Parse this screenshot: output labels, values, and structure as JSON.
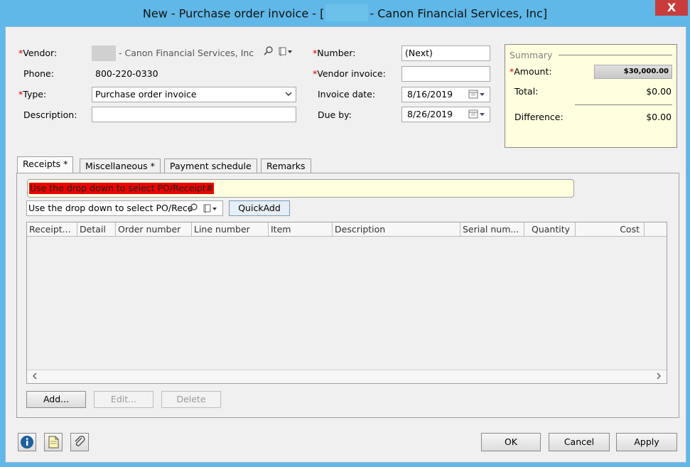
{
  "window": {
    "title_prefix": "New - Purchase order invoice - [",
    "title_suffix": "- Canon Financial Services, Inc]",
    "close_glyph": "X"
  },
  "form": {
    "vendor_label": "Vendor:",
    "vendor_value": "- Canon Financial Services, Inc",
    "phone_label": "Phone:",
    "phone_value": "800-220-0330",
    "type_label": "Type:",
    "type_value": "Purchase order invoice",
    "description_label": "Description:",
    "description_value": "",
    "number_label": "Number:",
    "number_value": "(Next)",
    "vendor_invoice_label": "Vendor invoice:",
    "vendor_invoice_value": "",
    "invoice_date_label": "Invoice date:",
    "invoice_date_value": "8/16/2019",
    "due_by_label": "Due by:",
    "due_by_value": "8/26/2019",
    "required_mark": "*"
  },
  "summary": {
    "title": "Summary",
    "amount_label": "Amount:",
    "amount_value": "$30,000.00",
    "total_label": "Total:",
    "total_value": "$0.00",
    "difference_label": "Difference:",
    "difference_value": "$0.00"
  },
  "tabs": [
    {
      "label": "Receipts *"
    },
    {
      "label": "Miscellaneous *"
    },
    {
      "label": "Payment schedule"
    },
    {
      "label": "Remarks"
    }
  ],
  "receipts": {
    "warning": "Use the drop down to select PO/Receipt#",
    "po_input_value": "Use the drop down to select PO/Rece",
    "quickadd_label": "QuickAdd",
    "columns": [
      "Receipt...",
      "Detail",
      "Order number",
      "Line number",
      "Item",
      "Description",
      "Serial num...",
      "Quantity",
      "Cost"
    ],
    "add_label": "Add...",
    "edit_label": "Edit...",
    "delete_label": "Delete"
  },
  "footer": {
    "ok_label": "OK",
    "cancel_label": "Cancel",
    "apply_label": "Apply"
  },
  "colors": {
    "titlebar": "#5fb8e8",
    "required": "#d00000",
    "warning_bg": "#ee0000",
    "summary_bg": "#ffffe0"
  }
}
